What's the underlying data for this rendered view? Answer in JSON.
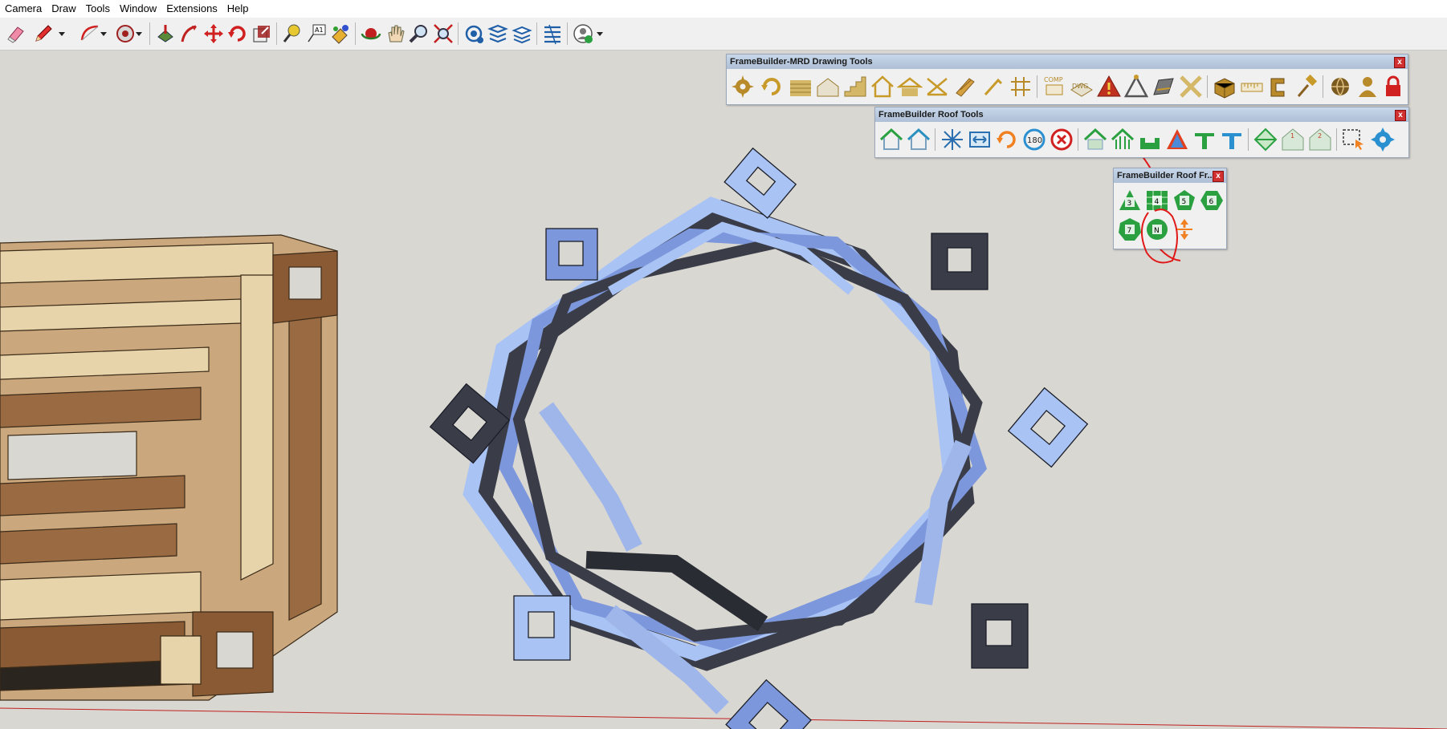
{
  "menu": [
    "Camera",
    "Draw",
    "Tools",
    "Window",
    "Extensions",
    "Help"
  ],
  "toolbar": {
    "tools": [
      "eraser-icon",
      "pencil-icon",
      "arc-icon",
      "shapes-icon",
      "paint-bucket-icon",
      "push-pull-icon",
      "move-icon",
      "rotate-icon",
      "scale-icon",
      "tape-measure-icon",
      "text-icon",
      "paint-icon",
      "orbit-icon",
      "pan-icon",
      "zoom-icon",
      "zoom-extents-icon",
      "warehouse-icon",
      "extension-manager-icon",
      "layers-icon",
      "outliner-icon",
      "account-icon"
    ]
  },
  "panels": {
    "drawing_tools": {
      "title": "FrameBuilder-MRD Drawing Tools",
      "close": "x",
      "comp_label": "COMP",
      "dwg_label": "DWG"
    },
    "roof_tools": {
      "title": "FrameBuilder Roof Tools",
      "close": "x",
      "rotate_label": "180"
    },
    "roof_frames": {
      "title": "FrameBuilder Roof Fr...",
      "close": "x",
      "buttons": [
        "3",
        "4",
        "5",
        "6",
        "7",
        "N"
      ]
    }
  },
  "colors": {
    "viewport": "#d9d7d2",
    "knot_light": "#a9c3f5",
    "knot_medium": "#7c97dc",
    "knot_dark": "#3a3d48",
    "wood_light": "#e6d3aa",
    "wood_dark": "#8a5a34",
    "annotation": "#e01818"
  }
}
